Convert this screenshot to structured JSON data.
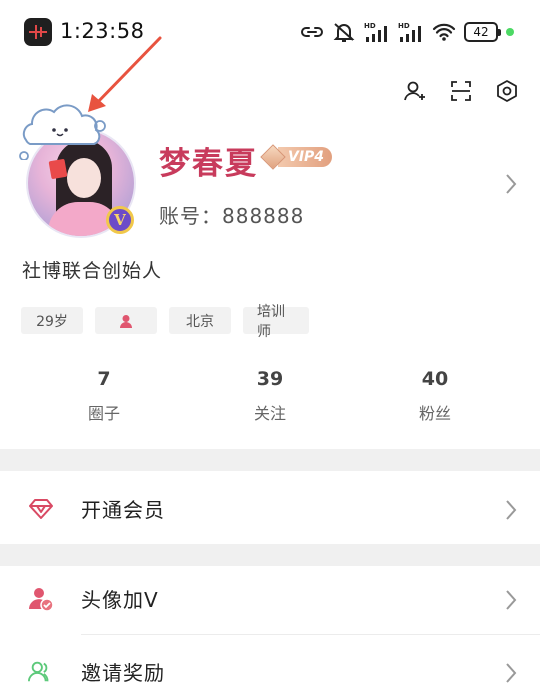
{
  "status_bar": {
    "time": "1:23:58",
    "battery": "42",
    "network_label": "HD"
  },
  "header": {
    "icons": [
      "add-friend-icon",
      "scan-icon",
      "settings-icon"
    ]
  },
  "profile": {
    "nickname": "梦春夏",
    "vip_level": "VIP4",
    "account": "账号：888888",
    "bio": "社博联合创始人",
    "verified_badge": "V",
    "tags": {
      "age": "29岁",
      "city": "北京",
      "job": "培训师"
    }
  },
  "stats": [
    {
      "value": "7",
      "label": "圈子"
    },
    {
      "value": "39",
      "label": "关注"
    },
    {
      "value": "40",
      "label": "粉丝"
    }
  ],
  "menu": {
    "membership": "开通会员",
    "avatar_v": "头像加V",
    "invite": "邀请奖励"
  },
  "colors": {
    "nickname": "#c83b5c",
    "accent": "#d94a64",
    "invite_icon": "#5cc97a",
    "separator": "#f0f0f0"
  }
}
